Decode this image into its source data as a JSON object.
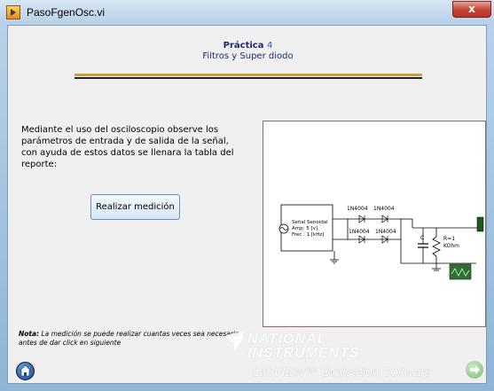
{
  "window": {
    "title": "PasoFgenOsc.vi",
    "close_label": "x",
    "icon": "labview-vi-icon"
  },
  "header": {
    "practice_label": "Práctica",
    "practice_number": "4",
    "subtitle": "Filtros y Super diodo"
  },
  "instructions": {
    "text": "Mediante el uso del osciloscopio observe los parámetros de entrada y de salida de la señal, con ayuda de estos datos se llenara la tabla del reporte:"
  },
  "measure_button": {
    "label": "Realizar medición"
  },
  "circuit": {
    "source_label": "Señal Senoidal",
    "source_amp": "Amp: 5 [v]",
    "source_freq": "Frec : 1 [kHz]",
    "diode_labels": [
      "1N4004",
      "1N4004",
      "1N4004",
      "1N4004"
    ],
    "capacitor_label": "C",
    "resistor_label_1": "R=1",
    "resistor_label_2": "KOhm"
  },
  "note": {
    "bold": "Nota:",
    "text": " La medición se puede realizar cuantas veces sea necesario antes de dar click en siguiente"
  },
  "nav": {
    "home_icon": "home-icon",
    "next_icon": "next-arrow-icon"
  },
  "watermark": {
    "line1": "NATIONAL",
    "line2": "INSTRUMENTS",
    "line3": "LabVIEW™ Evaluation Software"
  }
}
